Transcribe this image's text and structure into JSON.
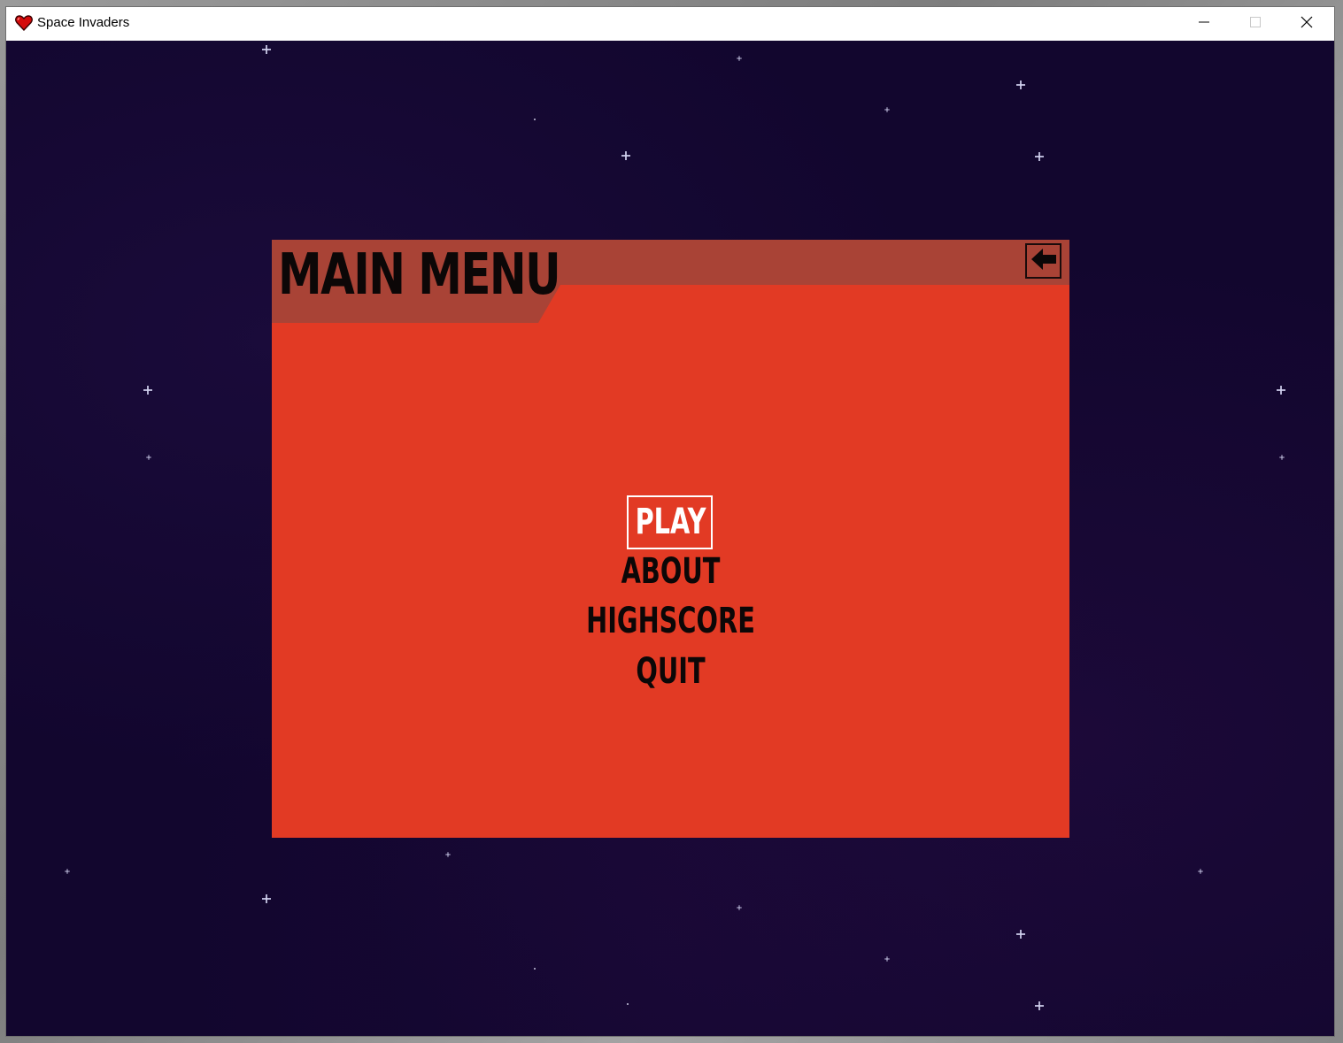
{
  "window": {
    "title": "Space Invaders",
    "app_icon": "heart-icon",
    "controls": [
      "minimize-icon",
      "maximize-icon",
      "close-icon"
    ]
  },
  "colors": {
    "space_background": "#12062e",
    "panel_body": "#e23a24",
    "panel_header": "#a94336",
    "text_dark": "#0c0707",
    "text_selected": "#ffffff"
  },
  "menu": {
    "title": "MAIN MENU",
    "back_icon": "arrow-left-icon",
    "items": [
      {
        "label": "PLAY",
        "selected": true
      },
      {
        "label": "ABOUT",
        "selected": false
      },
      {
        "label": "HIGHSCORE",
        "selected": false
      },
      {
        "label": "QUIT",
        "selected": false
      }
    ]
  }
}
